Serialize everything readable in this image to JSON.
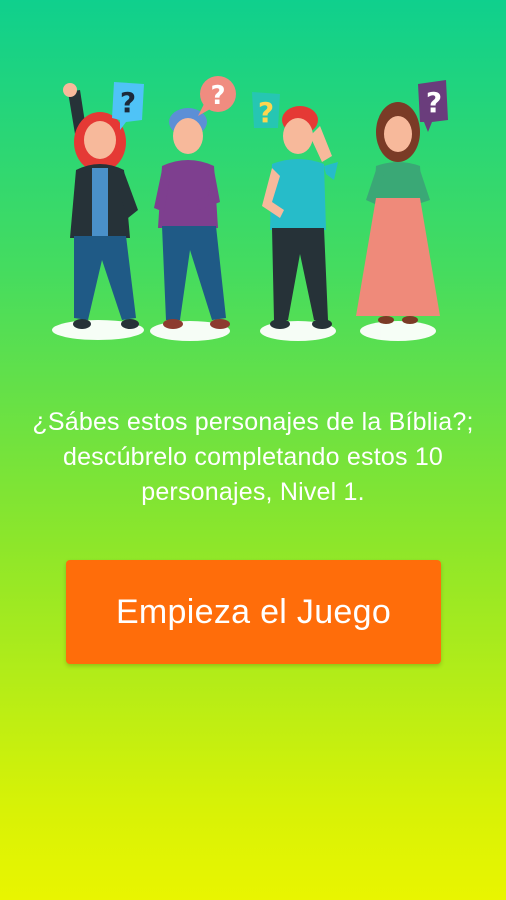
{
  "intro": {
    "text": "¿Sábes estos personajes de la Bíblia?; descúbrelo completando estos 10 personajes, Nivel 1."
  },
  "start_button": {
    "label": "Empieza el Juego"
  },
  "illustration": {
    "bubbles": [
      {
        "glyph": "?",
        "bg": "#4fc3f7",
        "fg": "#1c2a3a"
      },
      {
        "glyph": "?",
        "bg": "#f08c80",
        "fg": "#ffffff"
      },
      {
        "glyph": "?",
        "bg": "#26c6b2",
        "fg": "#ffd54f"
      },
      {
        "glyph": "?",
        "bg": "#6a3d7c",
        "fg": "#ffffff"
      }
    ]
  },
  "colors": {
    "button": "#ff6d0a",
    "gradient_top": "#0fd08d",
    "gradient_bottom": "#e9f500"
  }
}
